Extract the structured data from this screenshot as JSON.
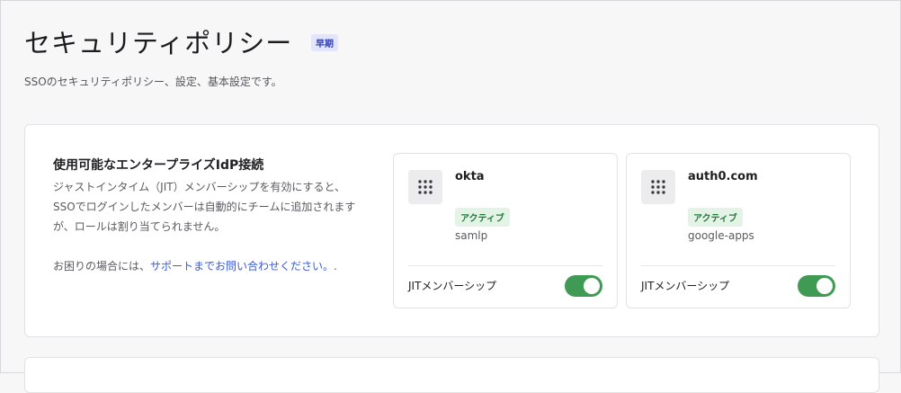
{
  "header": {
    "title": "セキュリティポリシー",
    "badge": "早期",
    "description": "SSOのセキュリティポリシー、設定、基本設定です。"
  },
  "enterprise_idp": {
    "title": "使用可能なエンタープライズIdP接続",
    "description": "ジャストインタイム（JIT）メンバーシップを有効にすると、SSOでログインしたメンバーは自動的にチームに追加されますが、ロールは割り当てられません。",
    "help_prefix": "お困りの場合には、",
    "help_link": "サポートまでお問い合わせください。",
    "help_suffix": "."
  },
  "connections": [
    {
      "name": "okta",
      "status": "アクティブ",
      "strategy": "samlp",
      "jit_label": "JITメンバーシップ",
      "jit_enabled": true
    },
    {
      "name": "auth0.com",
      "status": "アクティブ",
      "strategy": "google-apps",
      "jit_label": "JITメンバーシップ",
      "jit_enabled": true
    }
  ],
  "icons": {
    "drag": "grip-dots-icon"
  },
  "colors": {
    "badge_bg": "#e3e6fb",
    "badge_text": "#2f3fb8",
    "active_bg": "#e3f4e6",
    "active_text": "#1f7a3a",
    "toggle_on": "#3f9a54",
    "link": "#3b5bdb"
  }
}
